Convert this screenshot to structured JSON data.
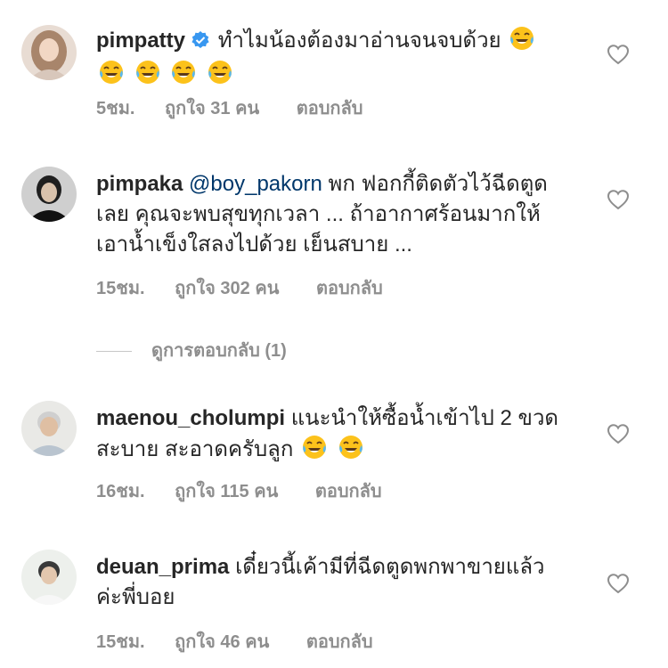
{
  "comments": [
    {
      "username": "pimpatty",
      "verified": true,
      "text": "ทำไมน้องต้องมาอ่านจนจบด้วย",
      "mention": "",
      "emoji": "tears-of-joy-emoji",
      "emoji_count": 5,
      "time": "5ชม.",
      "likes_prefix": "ถูกใจ",
      "likes_count": "31",
      "likes_suffix": "คน",
      "reply_label": "ตอบกลับ"
    },
    {
      "username": "pimpaka",
      "verified": false,
      "mention": "@boy_pakorn",
      "text": "พก ฟอกกี้ติดตัวไว้ฉีดตูดเลย  คุณจะพบสุขทุกเวลา ... ถ้าอากาศร้อนมากให้เอาน้ำเข็งใสลงไปด้วย เย็นสบาย ...",
      "time": "15ชม.",
      "likes_prefix": "ถูกใจ",
      "likes_count": "302",
      "likes_suffix": "คน",
      "reply_label": "ตอบกลับ"
    },
    {
      "username": "maenou_cholumpi",
      "verified": false,
      "mention": "",
      "text": "แนะนำให้ซื้อน้ำเข้าไป 2 ขวด สะบาย สะอาดครับลูก",
      "emoji": "tears-of-joy-emoji",
      "emoji_count": 2,
      "time": "16ชม.",
      "likes_prefix": "ถูกใจ",
      "likes_count": "115",
      "likes_suffix": "คน",
      "reply_label": "ตอบกลับ"
    },
    {
      "username": "deuan_prima",
      "verified": false,
      "mention": "",
      "text": "เดี๋ยวนี้เค้ามีที่ฉีดตูดพกพาขายแล้วค่ะพี่บอย",
      "time": "15ชม.",
      "likes_prefix": "ถูกใจ",
      "likes_count": "46",
      "likes_suffix": "คน",
      "reply_label": "ตอบกลับ"
    }
  ],
  "view_replies": "ดูการตอบกลับ (1)",
  "colors": {
    "text": "#262626",
    "muted": "#8e8e8e",
    "mention": "#00376b",
    "verified": "#3897f0"
  }
}
